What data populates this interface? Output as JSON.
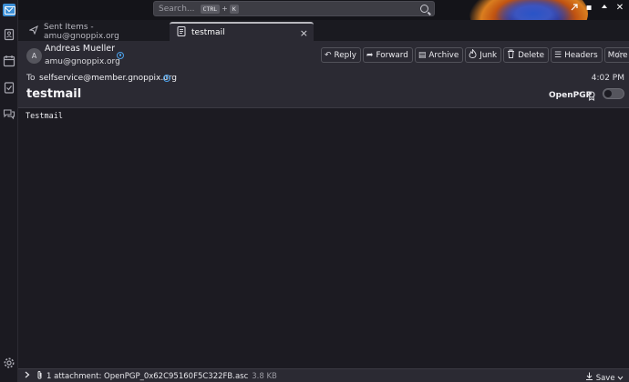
{
  "search": {
    "placeholder": "Search...",
    "shortcut_key1": "CTRL",
    "shortcut_plus": "+",
    "shortcut_key2": "K"
  },
  "tabs": [
    {
      "label": "Sent Items - amu@gnoppix.org",
      "icon": "paper-plane-icon",
      "active": false
    },
    {
      "label": "testmail",
      "icon": "message-icon",
      "active": true,
      "close": "×"
    }
  ],
  "message": {
    "avatar_initial": "A",
    "from_name": "Andreas Mueller",
    "from_address": "amu@gnoppix.org",
    "to_label": "To",
    "to_address": "selfservice@member.gnoppix.org",
    "time": "4:02 PM",
    "subject": "testmail",
    "openpgp_label": "OpenPGP",
    "body": "Testmail"
  },
  "actions": [
    {
      "label": "Reply",
      "icon": "reply-icon",
      "glyph": "↶"
    },
    {
      "label": "Forward",
      "icon": "forward-icon",
      "glyph": "➦"
    },
    {
      "label": "Archive",
      "icon": "archive-icon",
      "glyph": "▤"
    },
    {
      "label": "Junk",
      "icon": "junk-icon",
      "glyph": "🔥"
    },
    {
      "label": "Delete",
      "icon": "trash-icon",
      "glyph": "🗑"
    },
    {
      "label": "Headers",
      "icon": "headers-icon",
      "glyph": "☰"
    },
    {
      "label": "More",
      "icon": "chevron-down-icon",
      "glyph": "⌄"
    }
  ],
  "attachment": {
    "summary": "1 attachment: OpenPGP_0x62C95160F5C322FB.asc",
    "size": "3.8 KB",
    "save_label": "Save"
  },
  "colors": {
    "accent": "#3c8fd6",
    "background": "#1c1b22",
    "header_bg": "#2b2a33"
  }
}
